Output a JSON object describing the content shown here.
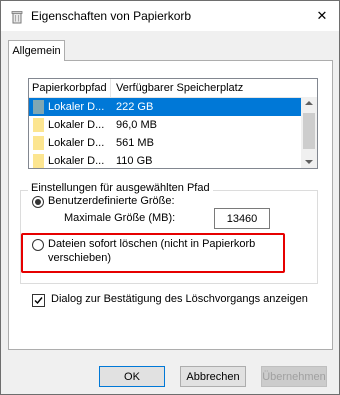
{
  "window": {
    "title": "Eigenschaften von Papierkorb",
    "close_glyph": "✕",
    "icons": {
      "title": "recycle-bin-icon",
      "close": "close-icon"
    }
  },
  "tabs": [
    {
      "label": "Allgemein",
      "selected": true
    }
  ],
  "listview": {
    "columns": [
      "Papierkorbpfad",
      "Verfügbarer Speicherplatz"
    ],
    "rows": [
      {
        "path": "Lokaler D...",
        "size": "222 GB",
        "selected": true
      },
      {
        "path": "Lokaler D...",
        "size": "96,0 MB",
        "selected": false
      },
      {
        "path": "Lokaler D...",
        "size": "561 MB",
        "selected": false
      },
      {
        "path": "Lokaler D...",
        "size": "110 GB",
        "selected": false
      }
    ],
    "folder_color": "#fce590",
    "selection_color": "#0078d7"
  },
  "settings": {
    "legend": "Einstellungen für ausgewählten Pfad",
    "option_custom": {
      "label": "Benutzerdefinierte Größe:",
      "selected": true
    },
    "max_size_label": "Maximale Größe (MB):",
    "max_size_value": "13460",
    "option_delete": {
      "label_line1": "Dateien sofort löschen (nicht in Papierkorb",
      "label_line2": "verschieben)",
      "selected": false,
      "highlight_color": "#e60000"
    }
  },
  "confirm_dialog": {
    "label": "Dialog zur Bestätigung des Löschvorgangs anzeigen",
    "checked": true
  },
  "buttons": {
    "ok": "OK",
    "cancel": "Abbrechen",
    "apply": "Übernehmen",
    "apply_enabled": false
  }
}
